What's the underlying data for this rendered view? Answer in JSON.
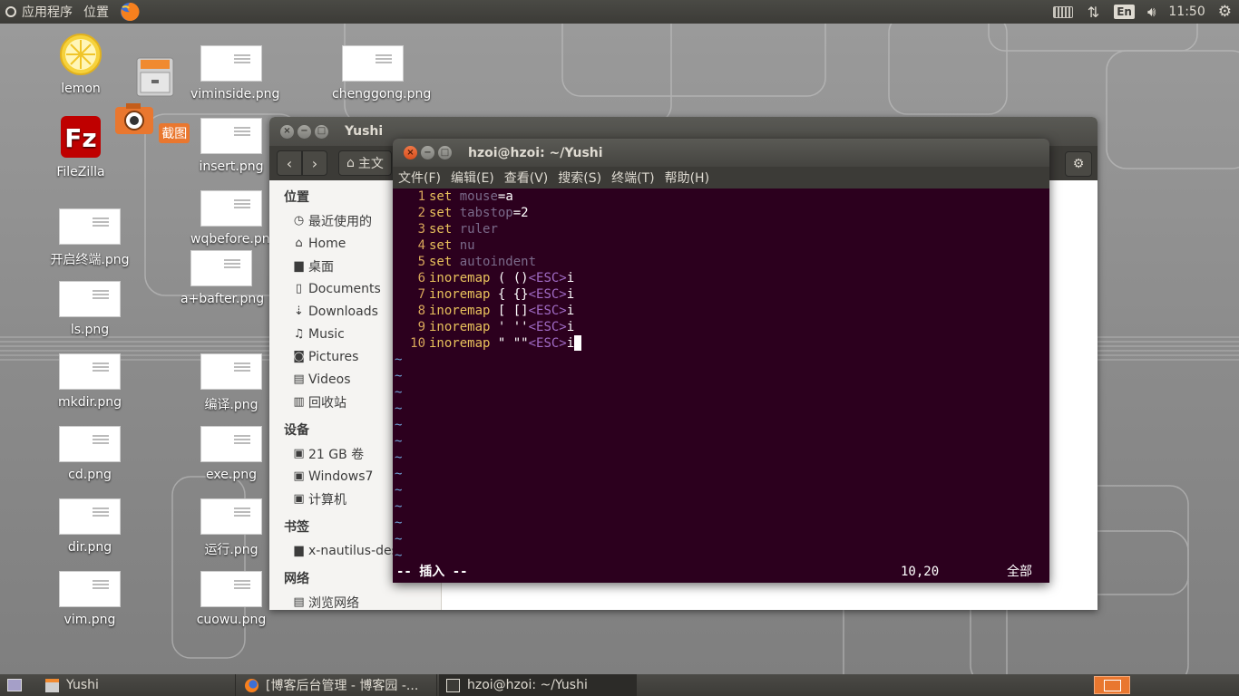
{
  "top_panel": {
    "applications": "应用程序",
    "places": "位置",
    "lang": "En",
    "clock": "11:50"
  },
  "desktop_icons": [
    {
      "label": "lemon"
    },
    {
      "label": "FileZilla"
    },
    {
      "label": "截图"
    },
    {
      "label": "viminside.png"
    },
    {
      "label": "insert.png"
    },
    {
      "label": "wqbefore.png"
    },
    {
      "label": "a+bafter.png"
    },
    {
      "label": "chenggong.png"
    },
    {
      "label": "开启终端.png"
    },
    {
      "label": "ls.png"
    },
    {
      "label": "mkdir.png"
    },
    {
      "label": "编译.png"
    },
    {
      "label": "cd.png"
    },
    {
      "label": "exe.png"
    },
    {
      "label": "dir.png"
    },
    {
      "label": "运行.png"
    },
    {
      "label": "vim.png"
    },
    {
      "label": "cuowu.png"
    }
  ],
  "nautilus": {
    "title": "Yushi",
    "path_home": "主文",
    "sidebar": {
      "places_header": "位置",
      "places": [
        "最近使用的",
        "Home",
        "桌面",
        "Documents",
        "Downloads",
        "Music",
        "Pictures",
        "Videos",
        "回收站"
      ],
      "devices_header": "设备",
      "devices": [
        "21 GB 卷",
        "Windows7",
        "计算机"
      ],
      "bookmarks_header": "书签",
      "bookmarks": [
        "x-nautilus-des"
      ],
      "network_header": "网络",
      "network": [
        "浏览网络"
      ]
    }
  },
  "terminal": {
    "title": "hzoi@hzoi: ~/Yushi",
    "menu": [
      "文件(F)",
      "编辑(E)",
      "查看(V)",
      "搜索(S)",
      "终端(T)",
      "帮助(H)"
    ],
    "lines": [
      {
        "n": "1",
        "parts": [
          [
            "kw",
            "set"
          ],
          [
            "t",
            " "
          ],
          [
            "op",
            "mouse"
          ],
          [
            "t",
            "=a"
          ]
        ]
      },
      {
        "n": "2",
        "parts": [
          [
            "kw",
            "set"
          ],
          [
            "t",
            " "
          ],
          [
            "op",
            "tabstop"
          ],
          [
            "t",
            "=2"
          ]
        ]
      },
      {
        "n": "3",
        "parts": [
          [
            "kw",
            "set"
          ],
          [
            "t",
            " "
          ],
          [
            "op",
            "ruler"
          ]
        ]
      },
      {
        "n": "4",
        "parts": [
          [
            "kw",
            "set"
          ],
          [
            "t",
            " "
          ],
          [
            "op",
            "nu"
          ]
        ]
      },
      {
        "n": "5",
        "parts": [
          [
            "kw",
            "set"
          ],
          [
            "t",
            " "
          ],
          [
            "op",
            "autoindent"
          ]
        ]
      },
      {
        "n": "6",
        "parts": [
          [
            "kw",
            "inoremap"
          ],
          [
            "t",
            " ( ()"
          ],
          [
            "esc",
            "<ESC>"
          ],
          [
            "t",
            "i"
          ]
        ]
      },
      {
        "n": "7",
        "parts": [
          [
            "kw",
            "inoremap"
          ],
          [
            "t",
            " { {}"
          ],
          [
            "esc",
            "<ESC>"
          ],
          [
            "t",
            "i"
          ]
        ]
      },
      {
        "n": "8",
        "parts": [
          [
            "kw",
            "inoremap"
          ],
          [
            "t",
            " [ []"
          ],
          [
            "esc",
            "<ESC>"
          ],
          [
            "t",
            "i"
          ]
        ]
      },
      {
        "n": "9",
        "parts": [
          [
            "kw",
            "inoremap"
          ],
          [
            "t",
            " ' ''"
          ],
          [
            "esc",
            "<ESC>"
          ],
          [
            "t",
            "i"
          ]
        ]
      },
      {
        "n": "10",
        "parts": [
          [
            "kw",
            "inoremap"
          ],
          [
            "t",
            " \" \"\""
          ],
          [
            "esc",
            "<ESC>"
          ],
          [
            "t",
            "i"
          ]
        ]
      }
    ],
    "status_mode": "-- 插入 --",
    "status_pos": "10,20",
    "status_all": "全部"
  },
  "taskbar": {
    "tasks": [
      "Yushi",
      "[博客后台管理 - 博客园 -...",
      "hzoi@hzoi: ~/Yushi"
    ]
  }
}
